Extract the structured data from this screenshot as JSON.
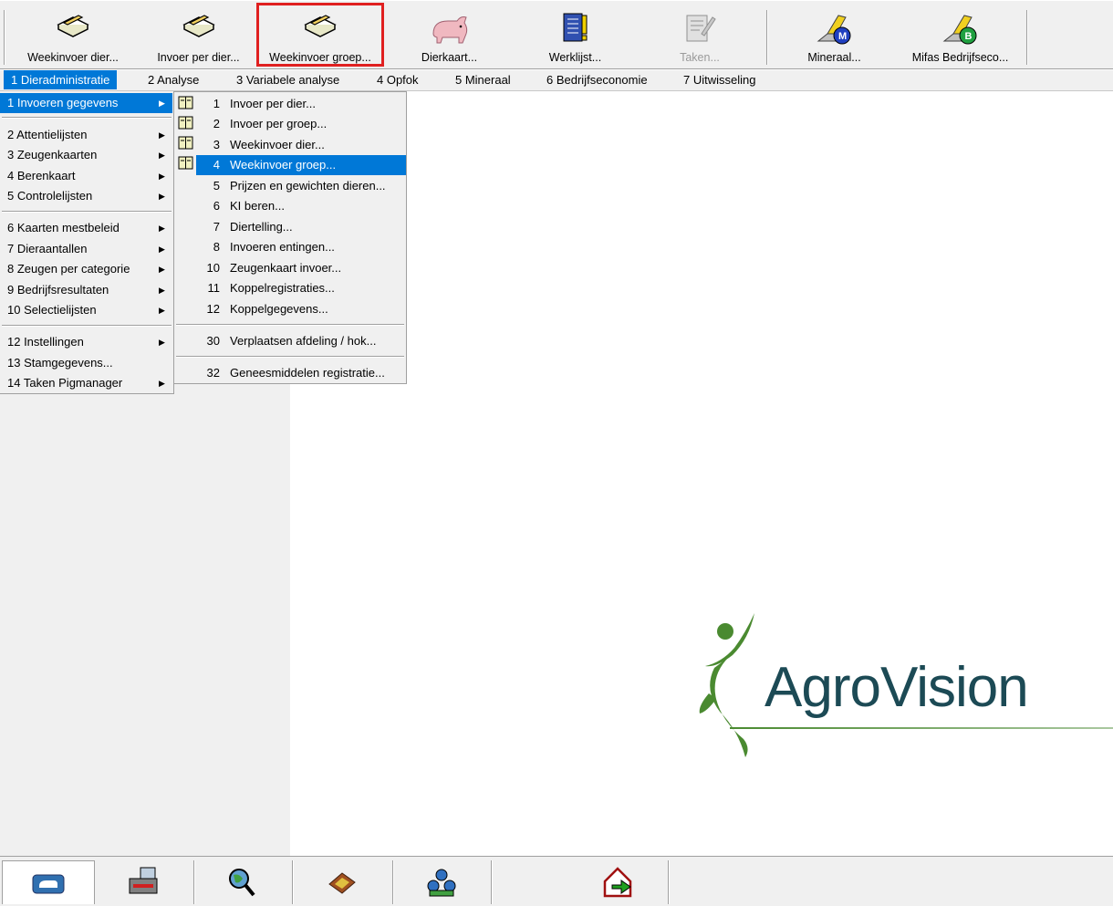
{
  "toolbar": {
    "buttons": [
      {
        "label": "Weekinvoer dier...",
        "icon": "book-pencil-icon"
      },
      {
        "label": "Invoer per dier...",
        "icon": "book-pencil-icon"
      },
      {
        "label": "Weekinvoer groep...",
        "icon": "book-pencil-icon"
      },
      {
        "label": "Dierkaart...",
        "icon": "pig-icon"
      },
      {
        "label": "Werklijst...",
        "icon": "checklist-icon"
      },
      {
        "label": "Taken...",
        "icon": "tasks-icon",
        "disabled": true
      },
      {
        "label": "Mineraal...",
        "icon": "mifas-m-icon"
      },
      {
        "label": "Mifas Bedrijfseco...",
        "icon": "mifas-b-icon"
      }
    ]
  },
  "menubar": {
    "items": [
      {
        "label": "1  Dieradministratie"
      },
      {
        "label": "2  Analyse"
      },
      {
        "label": "3  Variabele analyse"
      },
      {
        "label": "4  Opfok"
      },
      {
        "label": "5  Mineraal"
      },
      {
        "label": "6  Bedrijfseconomie"
      },
      {
        "label": "7  Uitwisseling"
      }
    ]
  },
  "menu": {
    "items": [
      {
        "label": "1  Invoeren gegevens"
      },
      {
        "label": "2  Attentielijsten"
      },
      {
        "label": "3  Zeugenkaarten"
      },
      {
        "label": "4  Berenkaart"
      },
      {
        "label": "5  Controlelijsten"
      },
      {
        "label": "6  Kaarten mestbeleid"
      },
      {
        "label": "7  Dieraantallen"
      },
      {
        "label": "8  Zeugen per categorie"
      },
      {
        "label": "9  Bedrijfsresultaten"
      },
      {
        "label": "10  Selectielijsten"
      },
      {
        "label": "12  Instellingen"
      },
      {
        "label": "13  Stamgegevens..."
      },
      {
        "label": "14  Taken Pigmanager"
      }
    ]
  },
  "submenu": {
    "items": [
      {
        "num": "1",
        "label": "Invoer per dier..."
      },
      {
        "num": "2",
        "label": "Invoer per groep..."
      },
      {
        "num": "3",
        "label": "Weekinvoer dier..."
      },
      {
        "num": "4",
        "label": "Weekinvoer groep..."
      },
      {
        "num": "5",
        "label": "Prijzen en gewichten dieren..."
      },
      {
        "num": "6",
        "label": "KI beren..."
      },
      {
        "num": "7",
        "label": "Diertelling..."
      },
      {
        "num": "8",
        "label": "Invoeren entingen..."
      },
      {
        "num": "10",
        "label": "Zeugenkaart invoer..."
      },
      {
        "num": "11",
        "label": "Koppelregistraties..."
      },
      {
        "num": "12",
        "label": "Koppelgegevens..."
      },
      {
        "num": "30",
        "label": "Verplaatsen afdeling / hok..."
      },
      {
        "num": "32",
        "label": "Geneesmiddelen registratie..."
      }
    ]
  },
  "logo": {
    "text": "AgroVision"
  },
  "colors": {
    "highlight": "#0078d7",
    "callout": "#e02020",
    "logo_text": "#1c4a55",
    "logo_green": "#4a8a30"
  },
  "bottombar": {
    "buttons": [
      {
        "icon": "animal-card-icon"
      },
      {
        "icon": "printer-icon"
      },
      {
        "icon": "globe-search-icon"
      },
      {
        "icon": "book-icon"
      },
      {
        "icon": "group-icon"
      },
      {
        "icon": "exit-house-icon"
      }
    ]
  }
}
